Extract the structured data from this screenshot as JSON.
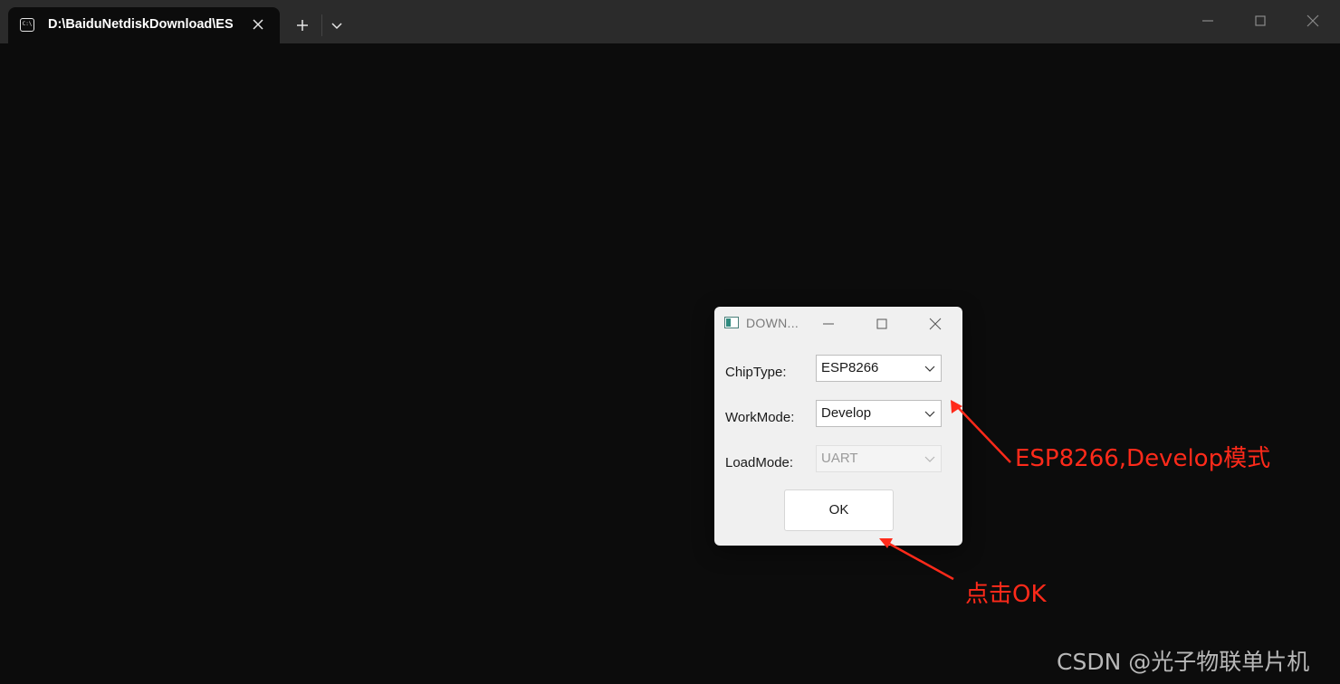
{
  "terminal": {
    "tab_title": "D:\\BaiduNetdiskDownload\\ES",
    "tab_icon": "terminal-icon",
    "icons": {
      "close": "close-icon",
      "new_tab": "plus-icon",
      "dropdown": "chevron-down-icon",
      "minimize": "minimize-icon",
      "maximize": "maximize-icon",
      "window_close": "close-icon"
    }
  },
  "dialog": {
    "title": "DOWN...",
    "fields": [
      {
        "label": "ChipType:",
        "value": "ESP8266",
        "enabled": true
      },
      {
        "label": "WorkMode:",
        "value": "Develop",
        "enabled": true
      },
      {
        "label": "LoadMode:",
        "value": "UART",
        "enabled": false
      }
    ],
    "ok_label": "OK"
  },
  "annotations": {
    "mode_note": "ESP8266,Develop模式",
    "click_note": "点击OK",
    "color": "#ff2a1a"
  },
  "watermark": "CSDN @光子物联单片机"
}
